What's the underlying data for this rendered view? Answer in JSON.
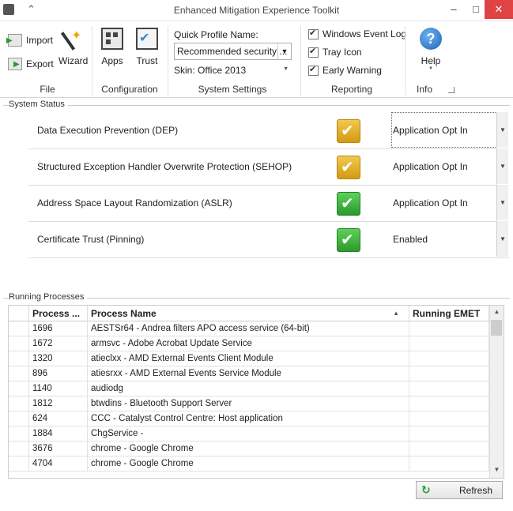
{
  "window": {
    "title": "Enhanced Mitigation Experience Toolkit",
    "minimize": "–",
    "maximize": "□",
    "close": "✕",
    "ribbon_collapse": "⌃"
  },
  "ribbon": {
    "file": {
      "label": "File",
      "import": "Import",
      "export": "Export",
      "wizard": "Wizard"
    },
    "configuration": {
      "label": "Configuration",
      "apps": "Apps",
      "trust": "Trust"
    },
    "system_settings": {
      "label": "System Settings",
      "quick_profile_label": "Quick Profile Name:",
      "quick_profile_value": "Recommended security ...",
      "skin": "Skin: Office 2013"
    },
    "reporting": {
      "label": "Reporting",
      "windows_event_log": "Windows Event Log",
      "tray_icon": "Tray Icon",
      "early_warning": "Early Warning"
    },
    "info": {
      "label": "Info",
      "help": "Help"
    }
  },
  "system_status": {
    "title": "System Status",
    "rows": [
      {
        "name": "Data Execution Prevention (DEP)",
        "status": "Application Opt In",
        "icon": "yellow-check-icon"
      },
      {
        "name": "Structured Exception Handler Overwrite Protection (SEHOP)",
        "status": "Application Opt In",
        "icon": "yellow-check-icon"
      },
      {
        "name": "Address Space Layout Randomization (ASLR)",
        "status": "Application Opt In",
        "icon": "green-check-icon"
      },
      {
        "name": "Certificate Trust (Pinning)",
        "status": "Enabled",
        "icon": "green-check-icon"
      }
    ]
  },
  "running_processes": {
    "title": "Running Processes",
    "columns": [
      "Process ...",
      "Process Name",
      "Running EMET"
    ],
    "rows": [
      [
        "1696",
        "AESTSr64 - Andrea filters APO access service (64-bit)",
        ""
      ],
      [
        "1672",
        "armsvc - Adobe Acrobat Update Service",
        ""
      ],
      [
        "1320",
        "atieclxx - AMD External Events Client Module",
        ""
      ],
      [
        "896",
        "atiesrxx - AMD External Events Service Module",
        ""
      ],
      [
        "1140",
        "audiodg",
        ""
      ],
      [
        "1812",
        "btwdins - Bluetooth Support Server",
        ""
      ],
      [
        "624",
        "CCC - Catalyst Control Centre: Host application",
        ""
      ],
      [
        "1884",
        "ChgService -",
        ""
      ],
      [
        "3676",
        "chrome - Google Chrome",
        ""
      ],
      [
        "4704",
        "chrome - Google Chrome",
        ""
      ]
    ],
    "refresh": "Refresh"
  },
  "colors": {
    "ok": "#2b9a2d",
    "warn": "#d39a12",
    "accent": "#1e73c8"
  }
}
